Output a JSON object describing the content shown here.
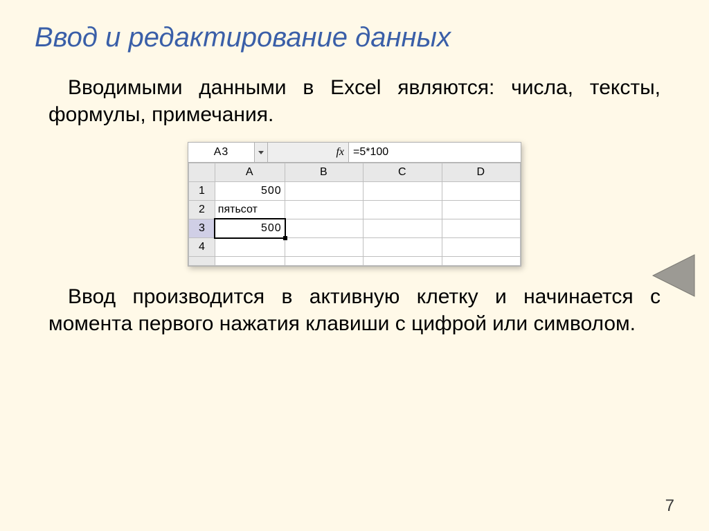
{
  "title": "Ввод и редактирование данных",
  "para1": "Вводимыми данными в Excel являются: числа, тексты, формулы, примечания.",
  "para2": "Ввод производится в активную клетку и начинается с момента первого нажатия клавиши с цифрой или символом.",
  "pageNumber": "7",
  "excel": {
    "nameBox": "A3",
    "fxLabel": "fx",
    "formula": "=5*100",
    "columns": [
      "A",
      "B",
      "C",
      "D"
    ],
    "rows": [
      {
        "num": "1",
        "A": "500",
        "align": "num",
        "selected": false
      },
      {
        "num": "2",
        "A": "пятьсот",
        "align": "txt",
        "selected": false
      },
      {
        "num": "3",
        "A": "500",
        "align": "num",
        "selected": true
      },
      {
        "num": "4",
        "A": "",
        "align": "txt",
        "selected": false
      }
    ]
  }
}
